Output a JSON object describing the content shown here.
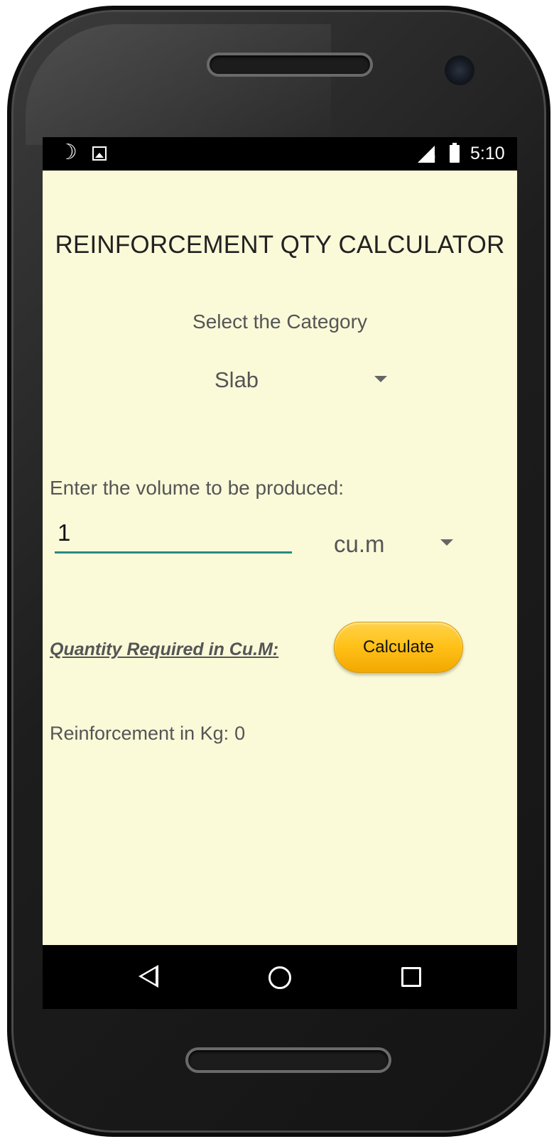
{
  "status_bar": {
    "left_icons": [
      "moon-icon",
      "image-icon"
    ],
    "right_icons": [
      "signal-icon",
      "battery-icon"
    ],
    "time": "5:10"
  },
  "app": {
    "title": "REINFORCEMENT QTY CALCULATOR",
    "category_label": "Select the Category",
    "category_selected": "Slab",
    "volume_label": "Enter the volume to be produced:",
    "volume_value": "1",
    "unit_selected": "cu.m",
    "quantity_label": "Quantity Required in Cu.M:",
    "calculate_label": "Calculate",
    "result_label": "Reinforcement in Kg:",
    "result_value": "0"
  },
  "nav_bar": {
    "icons": [
      "back-icon",
      "home-icon",
      "recents-icon"
    ]
  },
  "colors": {
    "screen_background": "#fafad9",
    "input_underline": "#2a8a80",
    "button_accent": "#ffc21a"
  }
}
